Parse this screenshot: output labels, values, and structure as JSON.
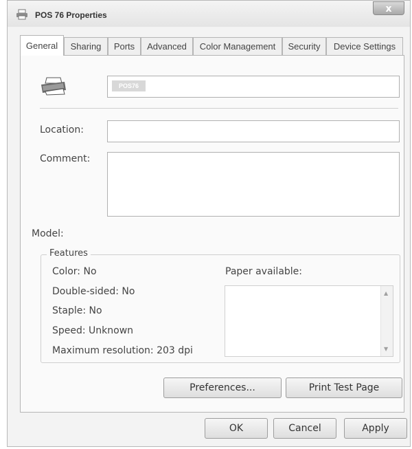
{
  "window": {
    "title": "POS 76 Properties",
    "close_label": "x"
  },
  "tabs": [
    {
      "label": "General",
      "active": true
    },
    {
      "label": "Sharing"
    },
    {
      "label": "Ports"
    },
    {
      "label": "Advanced"
    },
    {
      "label": "Color Management"
    },
    {
      "label": "Security"
    },
    {
      "label": "Device Settings"
    }
  ],
  "general": {
    "printer_name": "POS76",
    "location_label": "Location:",
    "location_value": "",
    "comment_label": "Comment:",
    "comment_value": "",
    "model_label": "Model:",
    "model_value": ""
  },
  "features": {
    "legend": "Features",
    "color": "Color: No",
    "double_sided": "Double-sided: No",
    "staple": "Staple: No",
    "speed": "Speed: Unknown",
    "max_resolution": "Maximum resolution: 203 dpi",
    "paper_available_label": "Paper available:",
    "paper_list": []
  },
  "actions": {
    "preferences": "Preferences...",
    "print_test_page": "Print Test Page"
  },
  "footer": {
    "ok": "OK",
    "cancel": "Cancel",
    "apply": "Apply"
  },
  "icons": {
    "title": "printer-icon",
    "general": "printer-icon"
  }
}
